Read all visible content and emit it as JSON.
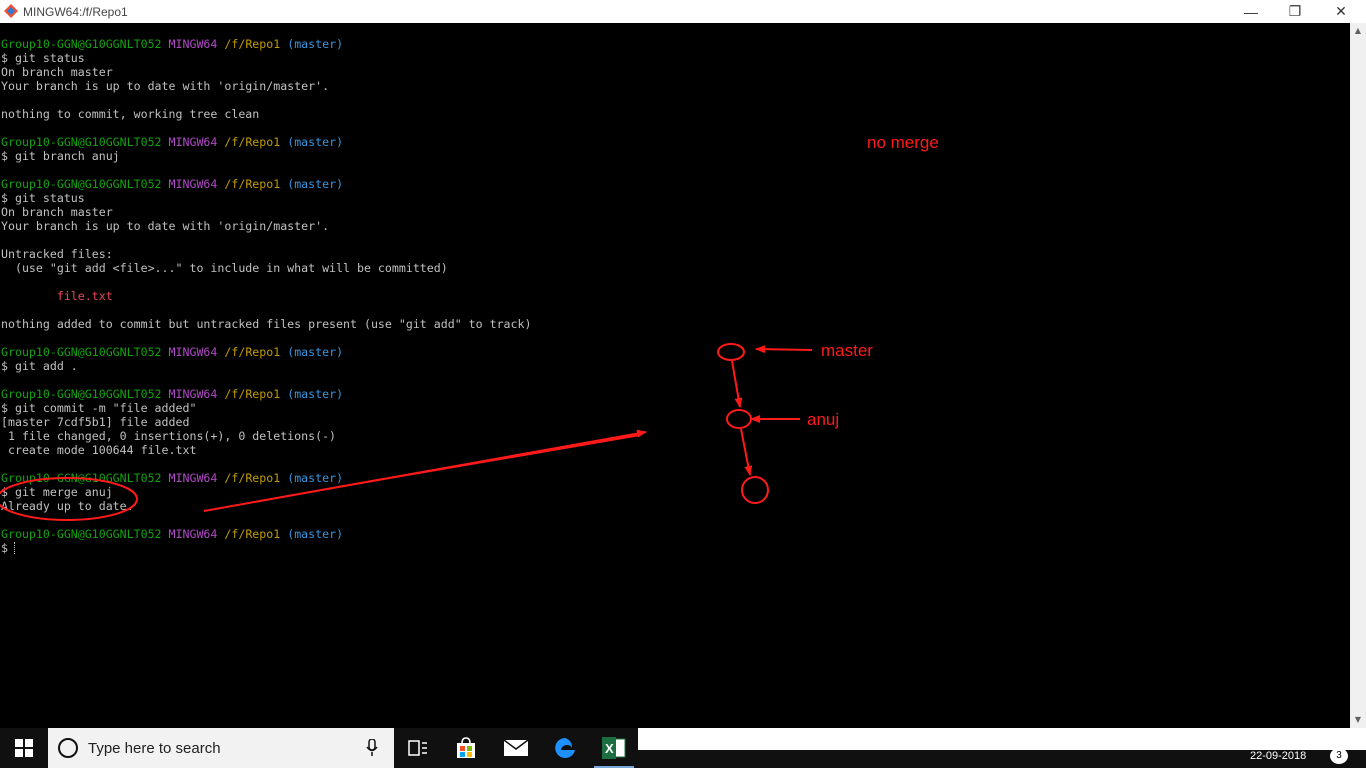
{
  "window": {
    "title": "MINGW64:/f/Repo1",
    "minimize_glyph": "—",
    "maximize_glyph": "❐",
    "close_glyph": "✕"
  },
  "terminal": {
    "lines": [
      {
        "type": "prompt",
        "user": "Group10-GGN@G10GGNLT052",
        "env": "MINGW64",
        "path": "/f/Repo1",
        "branch": "(master)"
      },
      {
        "type": "text",
        "text": "$ git status"
      },
      {
        "type": "text",
        "text": "On branch master"
      },
      {
        "type": "text",
        "text": "Your branch is up to date with 'origin/master'."
      },
      {
        "type": "text",
        "text": ""
      },
      {
        "type": "text",
        "text": "nothing to commit, working tree clean"
      },
      {
        "type": "text",
        "text": ""
      },
      {
        "type": "prompt",
        "user": "Group10-GGN@G10GGNLT052",
        "env": "MINGW64",
        "path": "/f/Repo1",
        "branch": "(master)"
      },
      {
        "type": "text",
        "text": "$ git branch anuj"
      },
      {
        "type": "text",
        "text": ""
      },
      {
        "type": "prompt",
        "user": "Group10-GGN@G10GGNLT052",
        "env": "MINGW64",
        "path": "/f/Repo1",
        "branch": "(master)"
      },
      {
        "type": "text",
        "text": "$ git status"
      },
      {
        "type": "text",
        "text": "On branch master"
      },
      {
        "type": "text",
        "text": "Your branch is up to date with 'origin/master'."
      },
      {
        "type": "text",
        "text": ""
      },
      {
        "type": "text",
        "text": "Untracked files:"
      },
      {
        "type": "text",
        "text": "  (use \"git add <file>...\" to include in what will be committed)"
      },
      {
        "type": "text",
        "text": ""
      },
      {
        "type": "untracked",
        "text": "        file.txt"
      },
      {
        "type": "text",
        "text": ""
      },
      {
        "type": "text",
        "text": "nothing added to commit but untracked files present (use \"git add\" to track)"
      },
      {
        "type": "text",
        "text": ""
      },
      {
        "type": "prompt",
        "user": "Group10-GGN@G10GGNLT052",
        "env": "MINGW64",
        "path": "/f/Repo1",
        "branch": "(master)"
      },
      {
        "type": "text",
        "text": "$ git add ."
      },
      {
        "type": "text",
        "text": ""
      },
      {
        "type": "prompt",
        "user": "Group10-GGN@G10GGNLT052",
        "env": "MINGW64",
        "path": "/f/Repo1",
        "branch": "(master)"
      },
      {
        "type": "text",
        "text": "$ git commit -m \"file added\""
      },
      {
        "type": "text",
        "text": "[master 7cdf5b1] file added"
      },
      {
        "type": "text",
        "text": " 1 file changed, 0 insertions(+), 0 deletions(-)"
      },
      {
        "type": "text",
        "text": " create mode 100644 file.txt"
      },
      {
        "type": "text",
        "text": ""
      },
      {
        "type": "prompt",
        "user": "Group10-GGN@G10GGNLT052",
        "env": "MINGW64",
        "path": "/f/Repo1",
        "branch": "(master)"
      },
      {
        "type": "text",
        "text": "$ git merge anuj"
      },
      {
        "type": "text",
        "text": "Already up to date."
      },
      {
        "type": "text",
        "text": ""
      },
      {
        "type": "prompt",
        "user": "Group10-GGN@G10GGNLT052",
        "env": "MINGW64",
        "path": "/f/Repo1",
        "branch": "(master)"
      },
      {
        "type": "cursor",
        "text": "$"
      }
    ]
  },
  "annotations": {
    "no_merge": "no merge",
    "master": "master",
    "anuj": "anuj",
    "color": "#ff1a1a"
  },
  "taskbar": {
    "search_placeholder": "Type here to search",
    "date": "22-09-2018",
    "notification_count": "3",
    "icons": [
      "windows-start-icon",
      "search-icon",
      "microphone-icon",
      "task-view-icon",
      "store-icon",
      "mail-icon",
      "edge-icon",
      "excel-icon"
    ]
  },
  "colors": {
    "prompt_user": "#13a10e",
    "prompt_env": "#b148c6",
    "prompt_path": "#c19c00",
    "prompt_branch": "#3a96dd",
    "untracked_file": "#e74856",
    "terminal_text": "#c0c0c0",
    "terminal_bg": "#000000",
    "taskbar_bg": "#101010"
  }
}
